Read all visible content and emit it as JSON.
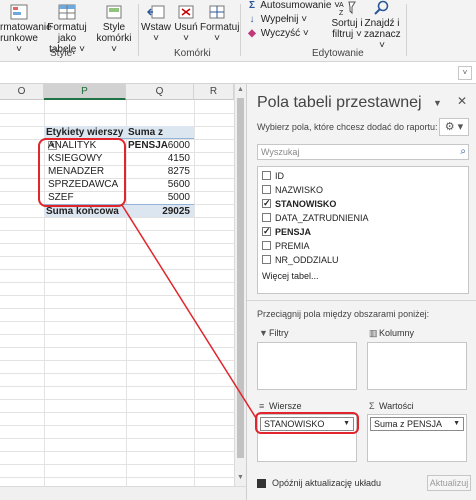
{
  "ribbon": {
    "style_group": {
      "label": "Style",
      "conditional_format": {
        "line1": "rmatowanie",
        "line2": "runkowe ˅"
      },
      "format_as_table": {
        "line1": "Formatuj jako",
        "line2": "tabelę ˅"
      },
      "cell_styles": {
        "line1": "Style",
        "line2": "komórki ˅"
      }
    },
    "cells_group": {
      "label": "Komórki",
      "insert": "Wstaw",
      "delete": "Usuń",
      "format": "Formatuj"
    },
    "edit_group": {
      "label": "Edytowanie",
      "autosum": "Autosumowanie ˅",
      "fill": "Wypełnij ˅",
      "clear": "Wyczyść ˅",
      "sort": {
        "line1": "Sortuj i",
        "line2": "filtruj ˅"
      },
      "find": {
        "line1": "Znajdź i",
        "line2": "zaznacz ˅"
      }
    }
  },
  "columns": [
    "O",
    "P",
    "Q",
    "R"
  ],
  "pivot": {
    "row_header": "Etykiety wierszy",
    "value_header": "Suma z PENSJA",
    "rows": [
      {
        "label": "ANALITYK",
        "value": "6000"
      },
      {
        "label": "KSIEGOWY",
        "value": "4150"
      },
      {
        "label": "MENADZER",
        "value": "8275"
      },
      {
        "label": "SPRZEDAWCA",
        "value": "5600"
      },
      {
        "label": "SZEF",
        "value": "5000"
      }
    ],
    "total_label": "Suma końcowa",
    "total_value": "29025"
  },
  "pane": {
    "title": "Pola tabeli przestawnej",
    "subtitle": "Wybierz pola, które chcesz dodać do raportu:",
    "search_placeholder": "Wyszukaj",
    "fields": [
      {
        "name": "ID",
        "checked": false
      },
      {
        "name": "NAZWISKO",
        "checked": false
      },
      {
        "name": "STANOWISKO",
        "checked": true
      },
      {
        "name": "DATA_ZATRUDNIENIA",
        "checked": false
      },
      {
        "name": "PENSJA",
        "checked": true
      },
      {
        "name": "PREMIA",
        "checked": false
      },
      {
        "name": "NR_ODDZIALU",
        "checked": false
      }
    ],
    "more_tables": "Więcej tabel...",
    "drag_hint": "Przeciągnij pola między obszarami poniżej:",
    "areas": {
      "filters": "Filtry",
      "columns": "Kolumny",
      "rows": "Wiersze",
      "values": "Wartości",
      "rows_item": "STANOWISKO",
      "values_item": "Suma z PENSJA"
    },
    "defer_update": "Opóźnij aktualizację układu",
    "update_button": "Aktualizuj"
  },
  "colors": {
    "accent": "#217346",
    "pivot_header": "#dce6f1",
    "highlight": "#e0262c"
  }
}
